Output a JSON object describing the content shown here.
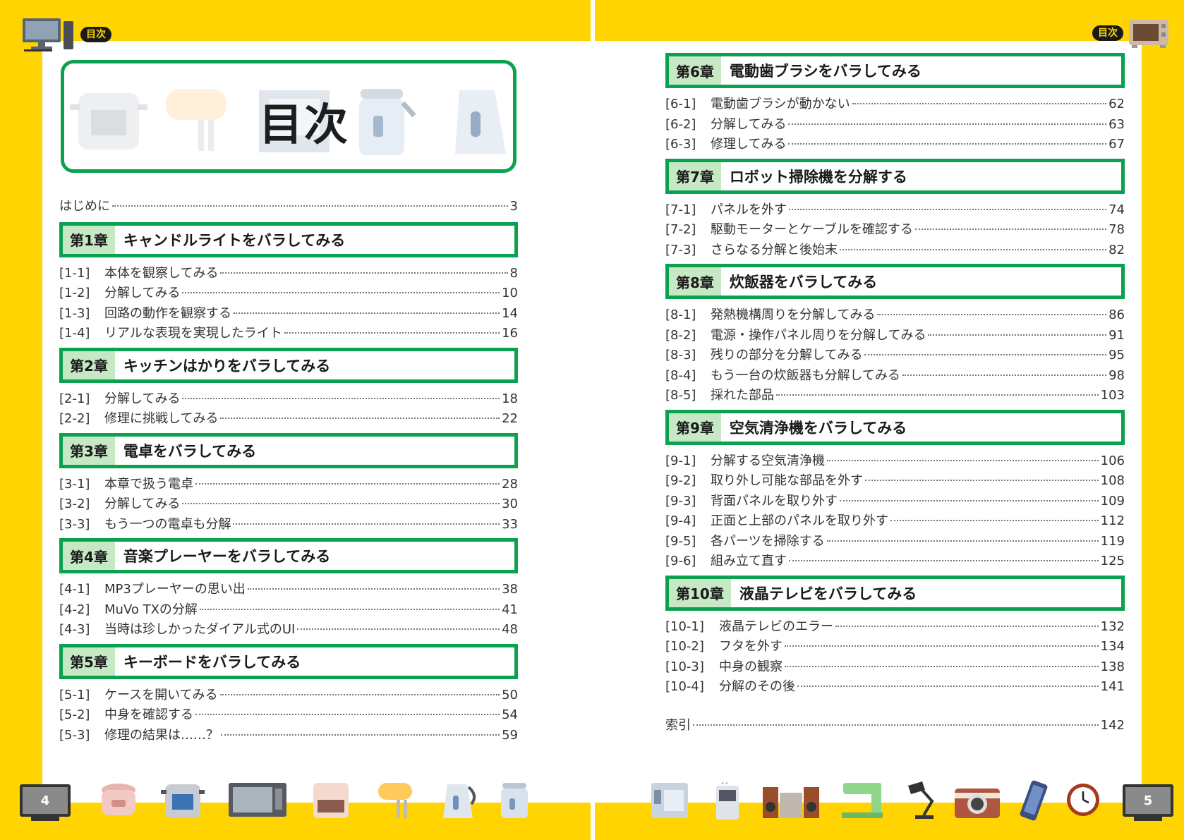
{
  "header": {
    "left_badge": "目次",
    "right_badge": "目次"
  },
  "title_panel": {
    "title": "目次"
  },
  "left_page": {
    "intro": {
      "title": "はじめに",
      "page": "3"
    },
    "chapters": [
      {
        "no": "第1章",
        "title": "キャンドルライトをバラしてみる",
        "entries": [
          {
            "num": "[1-1]",
            "title": "本体を観察してみる",
            "page": "8"
          },
          {
            "num": "[1-2]",
            "title": "分解してみる",
            "page": "10"
          },
          {
            "num": "[1-3]",
            "title": "回路の動作を観察する",
            "page": "14"
          },
          {
            "num": "[1-4]",
            "title": "リアルな表現を実現したライト",
            "page": "16"
          }
        ]
      },
      {
        "no": "第2章",
        "title": "キッチンはかりをバラしてみる",
        "entries": [
          {
            "num": "[2-1]",
            "title": "分解してみる",
            "page": "18"
          },
          {
            "num": "[2-2]",
            "title": "修理に挑戦してみる",
            "page": "22"
          }
        ]
      },
      {
        "no": "第3章",
        "title": "電卓をバラしてみる",
        "entries": [
          {
            "num": "[3-1]",
            "title": "本章で扱う電卓",
            "page": "28"
          },
          {
            "num": "[3-2]",
            "title": "分解してみる",
            "page": "30"
          },
          {
            "num": "[3-3]",
            "title": "もう一つの電卓も分解",
            "page": "33"
          }
        ]
      },
      {
        "no": "第4章",
        "title": "音楽プレーヤーをバラしてみる",
        "entries": [
          {
            "num": "[4-1]",
            "title": "MP3プレーヤーの思い出",
            "page": "38"
          },
          {
            "num": "[4-2]",
            "title": "MuVo TXの分解",
            "page": "41"
          },
          {
            "num": "[4-3]",
            "title": "当時は珍しかったダイアル式のUI",
            "page": "48"
          }
        ]
      },
      {
        "no": "第5章",
        "title": "キーボードをバラしてみる",
        "entries": [
          {
            "num": "[5-1]",
            "title": "ケースを開いてみる",
            "page": "50"
          },
          {
            "num": "[5-2]",
            "title": "中身を確認する",
            "page": "54"
          },
          {
            "num": "[5-3]",
            "title": "修理の結果は……？",
            "page": "59"
          }
        ]
      }
    ],
    "folio": "4"
  },
  "right_page": {
    "chapters": [
      {
        "no": "第6章",
        "title": "電動歯ブラシをバラしてみる",
        "entries": [
          {
            "num": "[6-1]",
            "title": "電動歯ブラシが動かない",
            "page": "62"
          },
          {
            "num": "[6-2]",
            "title": "分解してみる",
            "page": "63"
          },
          {
            "num": "[6-3]",
            "title": "修理してみる",
            "page": "67"
          }
        ]
      },
      {
        "no": "第7章",
        "title": "ロボット掃除機を分解する",
        "entries": [
          {
            "num": "[7-1]",
            "title": "パネルを外す",
            "page": "74"
          },
          {
            "num": "[7-2]",
            "title": "駆動モーターとケーブルを確認する",
            "page": "78"
          },
          {
            "num": "[7-3]",
            "title": "さらなる分解と後始末",
            "page": "82"
          }
        ]
      },
      {
        "no": "第8章",
        "title": "炊飯器をバラしてみる",
        "entries": [
          {
            "num": "[8-1]",
            "title": "発熱機構周りを分解してみる",
            "page": "86"
          },
          {
            "num": "[8-2]",
            "title": "電源・操作パネル周りを分解してみる",
            "page": "91"
          },
          {
            "num": "[8-3]",
            "title": "残りの部分を分解してみる",
            "page": "95"
          },
          {
            "num": "[8-4]",
            "title": "もう一台の炊飯器も分解してみる",
            "page": "98"
          },
          {
            "num": "[8-5]",
            "title": "採れた部品",
            "page": "103"
          }
        ]
      },
      {
        "no": "第9章",
        "title": "空気清浄機をバラしてみる",
        "entries": [
          {
            "num": "[9-1]",
            "title": "分解する空気清浄機",
            "page": "106"
          },
          {
            "num": "[9-2]",
            "title": "取り外し可能な部品を外す",
            "page": "108"
          },
          {
            "num": "[9-3]",
            "title": "背面パネルを取り外す",
            "page": "109"
          },
          {
            "num": "[9-4]",
            "title": "正面と上部のパネルを取り外す",
            "page": "112"
          },
          {
            "num": "[9-5]",
            "title": "各パーツを掃除する",
            "page": "119"
          },
          {
            "num": "[9-6]",
            "title": "組み立て直す",
            "page": "125"
          }
        ]
      },
      {
        "no": "第10章",
        "title": "液晶テレビをバラしてみる",
        "entries": [
          {
            "num": "[10-1]",
            "title": "液晶テレビのエラー",
            "page": "132"
          },
          {
            "num": "[10-2]",
            "title": "フタを外す",
            "page": "134"
          },
          {
            "num": "[10-3]",
            "title": "中身の観察",
            "page": "138"
          },
          {
            "num": "[10-4]",
            "title": "分解のその後",
            "page": "141"
          }
        ]
      }
    ],
    "index": {
      "title": "索引",
      "page": "142"
    },
    "folio": "5"
  },
  "colors": {
    "yellow": "#FFD400",
    "green_border": "#0AA14F",
    "chapter_tab": "#C7E8C4"
  },
  "icons": {
    "header_left": "desktop-computer-icon",
    "header_right": "toaster-oven-icon",
    "footer_left": [
      "rice-cooker-icon",
      "pressure-cooker-icon",
      "microwave-icon",
      "heater-icon",
      "hand-mixer-icon",
      "kettle-icon",
      "electric-pot-icon"
    ],
    "footer_right": [
      "water-dispenser-icon",
      "air-purifier-icon",
      "stereo-icon",
      "sewing-machine-icon",
      "desk-lamp-icon",
      "camera-icon",
      "smartphone-icon",
      "clock-icon"
    ]
  }
}
